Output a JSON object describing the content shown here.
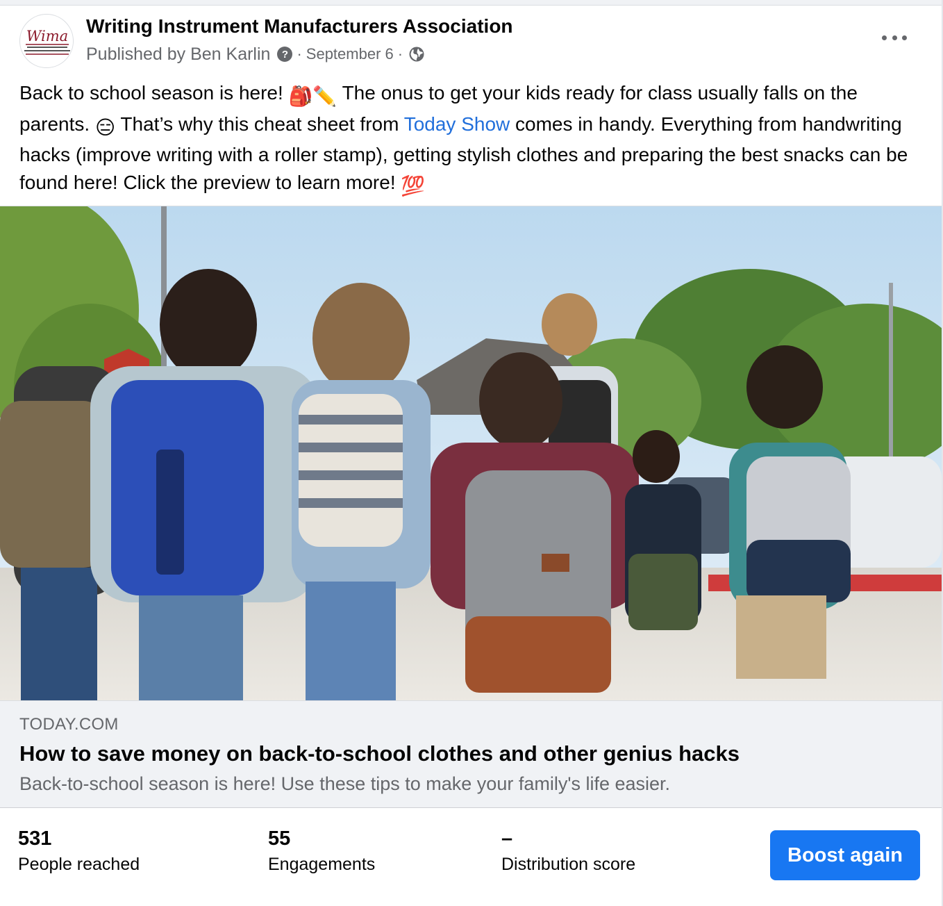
{
  "post": {
    "page_name": "Writing Instrument Manufacturers Association",
    "avatar_logo_text": "Wima",
    "avatar_logo_subtext": "Writing Instrument Manufacturers Association",
    "publisher": "Published by Ben Karlin",
    "help_icon": "?",
    "separator": "·",
    "date": "September 6",
    "audience_icon": "globe-icon",
    "more_icon": "more-options-icon",
    "text": {
      "part1": "Back to school season is here! ",
      "emoji1": "🎒",
      "emoji2": "✏️",
      "part2": " The onus to get your kids ready for class usually falls on the parents. ",
      "emoji3": "😑",
      "part3": " That’s why this cheat sheet from ",
      "link": "Today Show",
      "part4": " comes in handy. Everything from handwriting hacks (improve writing with a roller stamp), getting stylish clothes and preparing the best snacks can be found here! Click the preview to learn more! ",
      "emoji4": "💯"
    }
  },
  "link_preview": {
    "domain": "TODAY.COM",
    "title": "How to save money on back-to-school clothes and other genius hacks",
    "description": "Back-to-school season is here! Use these tips to make your family's life easier."
  },
  "stats": {
    "people_reached": {
      "value": "531",
      "label": "People reached"
    },
    "engagements": {
      "value": "55",
      "label": "Engagements"
    },
    "distribution_score": {
      "value": "–",
      "label": "Distribution score"
    }
  },
  "actions": {
    "boost_label": "Boost again"
  },
  "colors": {
    "accent": "#1877f2",
    "link": "#216fdb",
    "secondary_text": "#65676b",
    "preview_bg": "#f0f2f5",
    "logo_red": "#8b1a2b"
  }
}
